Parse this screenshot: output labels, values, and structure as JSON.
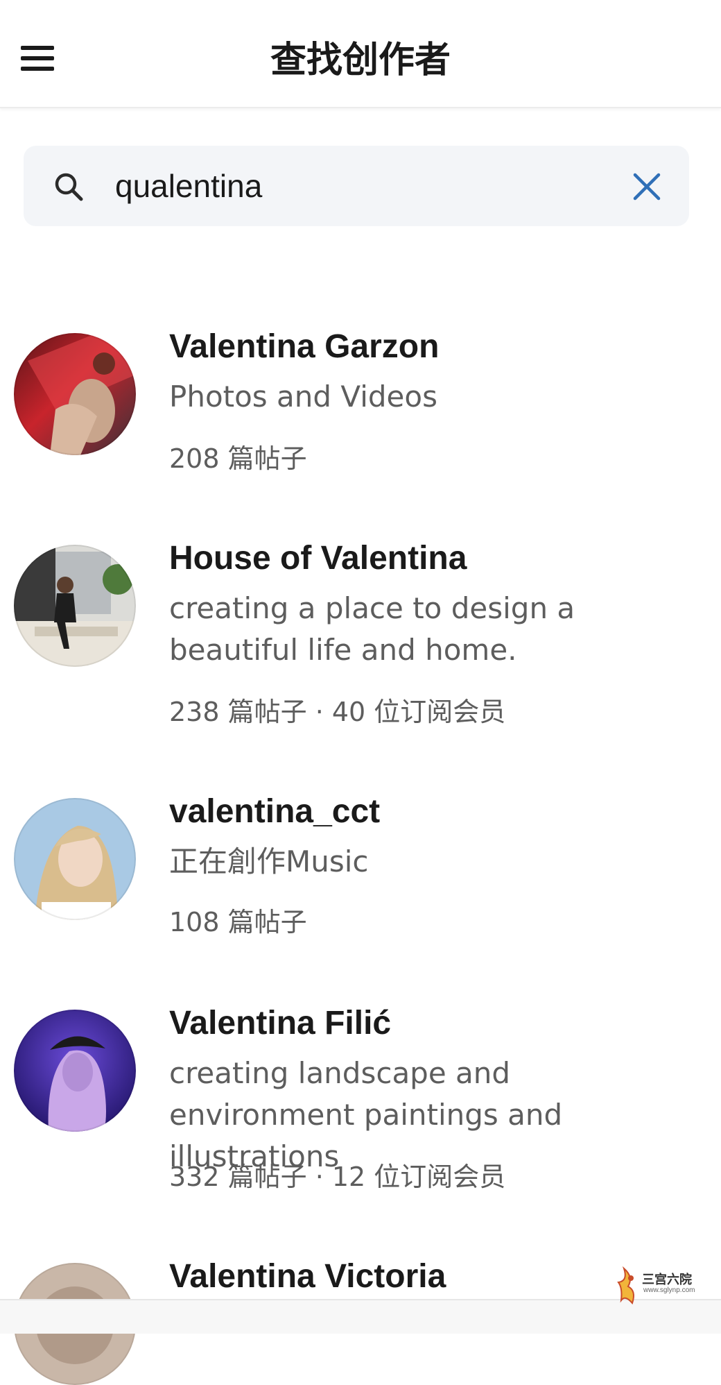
{
  "header": {
    "title": "查找创作者"
  },
  "search": {
    "value": "qualentina"
  },
  "results": [
    {
      "name": "Valentina Garzon",
      "description": "Photos and Videos",
      "stats": "208 篇帖子"
    },
    {
      "name": "House of Valentina",
      "description": "creating a place to design a beautiful life and home.",
      "stats": "238 篇帖子 · 40 位订阅会员"
    },
    {
      "name": "valentina_cct",
      "description": "正在創作Music",
      "stats": "108 篇帖子"
    },
    {
      "name": "Valentina Filić",
      "description": "creating landscape and environment paintings and illustrations",
      "stats": "332 篇帖子 · 12 位订阅会员"
    },
    {
      "name": "Valentina Victoria"
    }
  ],
  "watermark": {
    "title": "三宫六院",
    "url": "www.sglynp.com"
  },
  "colors": {
    "accent": "#2f6fb7",
    "text_primary": "#1a1a1a",
    "text_secondary": "#5d5d5d",
    "search_bg": "#f3f5f8"
  },
  "icons": {
    "menu": "menu-icon",
    "search": "search-icon",
    "clear": "close-icon"
  }
}
